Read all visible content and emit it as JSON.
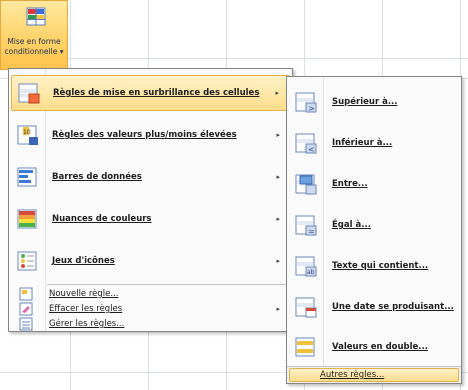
{
  "ribbon": {
    "label_line1": "Mise en forme",
    "label_line2": "conditionnelle ▾",
    "icon": "conditional-format-icon"
  },
  "main_menu": {
    "items": [
      {
        "label": "Règles de mise en surbrillance des cellules",
        "icon": "highlight-rules-icon",
        "submenu": true
      },
      {
        "label": "Règles des valeurs plus/moins élevées",
        "icon": "top-bottom-rules-icon",
        "submenu": true
      },
      {
        "label": "Barres de données",
        "icon": "data-bars-icon",
        "submenu": true
      },
      {
        "label": "Nuances de couleurs",
        "icon": "color-scales-icon",
        "submenu": true
      },
      {
        "label": "Jeux d'icônes",
        "icon": "icon-sets-icon",
        "submenu": true
      }
    ],
    "actions": [
      {
        "label": "Nouvelle règle...",
        "icon": "new-rule-icon"
      },
      {
        "label": "Effacer les règles",
        "icon": "clear-rules-icon",
        "submenu": true
      },
      {
        "label": "Gérer les règles...",
        "icon": "manage-rules-icon"
      }
    ]
  },
  "submenu": {
    "items": [
      {
        "label": "Supérieur à...",
        "icon": "greater-than-icon"
      },
      {
        "label": "Inférieur à...",
        "icon": "less-than-icon"
      },
      {
        "label": "Entre...",
        "icon": "between-icon"
      },
      {
        "label": "Égal à...",
        "icon": "equal-to-icon"
      },
      {
        "label": "Texte qui contient...",
        "icon": "text-contains-icon"
      },
      {
        "label": "Une date se produisant...",
        "icon": "date-occurring-icon"
      },
      {
        "label": "Valeurs en double...",
        "icon": "duplicate-values-icon"
      }
    ],
    "more": "Autres règles..."
  },
  "arrow": "▸"
}
